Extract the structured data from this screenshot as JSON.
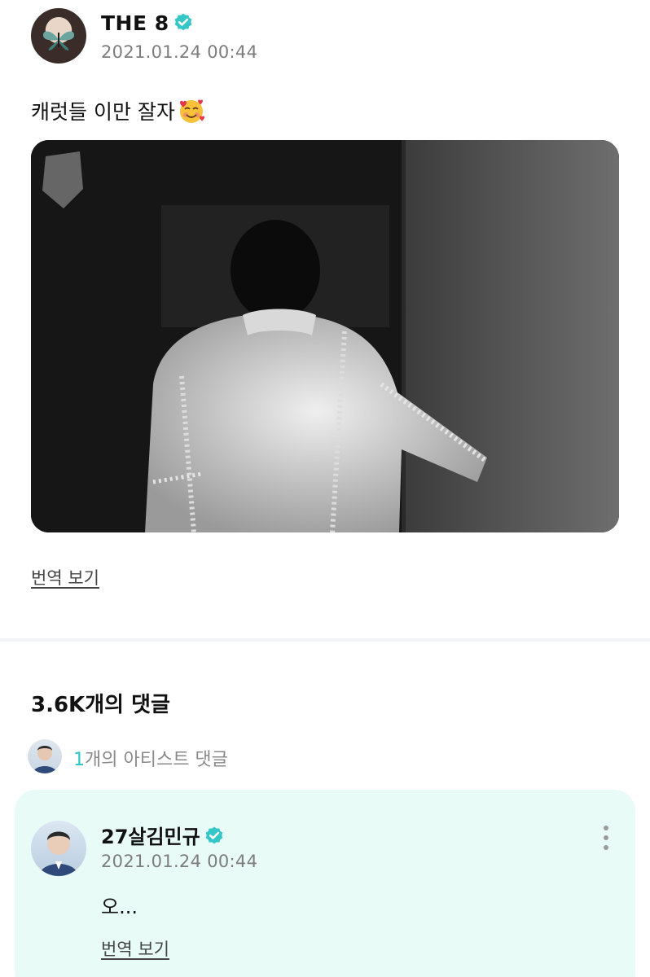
{
  "post": {
    "author": "THE 8",
    "date": "2021.01.24 00:44",
    "text": "캐럿들 이만 잘자",
    "emoji": "smiling-face-with-hearts-icon",
    "photo_description": "black-and-white-photo",
    "translate_label": "번역 보기"
  },
  "comments": {
    "title": "3.6K개의 댓글",
    "artist_count": "1",
    "artist_label": "개의 아티스트 댓글",
    "items": [
      {
        "author": "27살김민규",
        "date": "2021.01.24 00:44",
        "text": "오...",
        "translate_label": "번역 보기"
      }
    ]
  },
  "colors": {
    "accent": "#2dc4c4",
    "verified": "#35c6c8",
    "card_bg": "#e9fbf7",
    "muted": "#7d7d7d"
  }
}
